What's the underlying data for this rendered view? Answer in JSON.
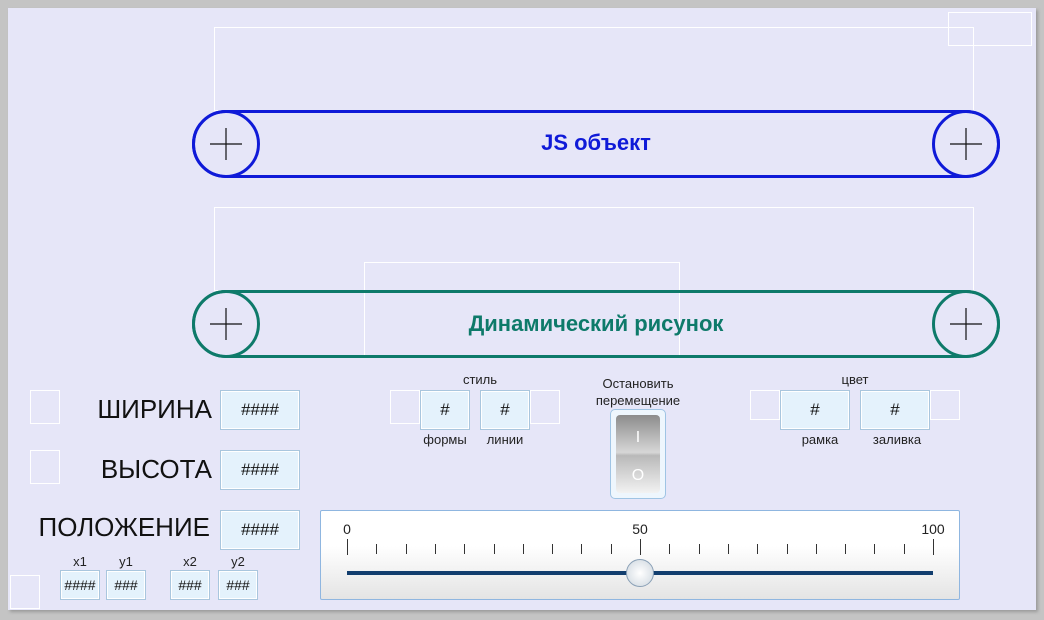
{
  "belts": [
    {
      "label": "JS объект",
      "color": "#0f1ad8"
    },
    {
      "label": "Динамический рисунок",
      "color": "#0e7a6a"
    }
  ],
  "size": {
    "width_label": "ШИРИНА",
    "width_value": "####",
    "height_label": "ВЫСОТА",
    "height_value": "####",
    "position_label": "ПОЛОЖЕНИЕ",
    "position_value": "####"
  },
  "coords": {
    "x1_label": "x1",
    "x1_value": "####",
    "y1_label": "y1",
    "y1_value": "###",
    "x2_label": "x2",
    "x2_value": "###",
    "y2_label": "y2",
    "y2_value": "###"
  },
  "style": {
    "title": "стиль",
    "shape_value": "#",
    "shape_label": "формы",
    "line_value": "#",
    "line_label": "линии"
  },
  "stop": {
    "label_line1": "Остановить",
    "label_line2": "перемещение",
    "on_symbol": "I",
    "off_symbol": "O"
  },
  "color": {
    "title": "цвет",
    "border_value": "#",
    "border_label": "рамка",
    "fill_value": "#",
    "fill_label": "заливка"
  },
  "slider": {
    "min_label": "0",
    "mid_label": "50",
    "max_label": "100",
    "min": 0,
    "max": 100,
    "value": 50
  }
}
